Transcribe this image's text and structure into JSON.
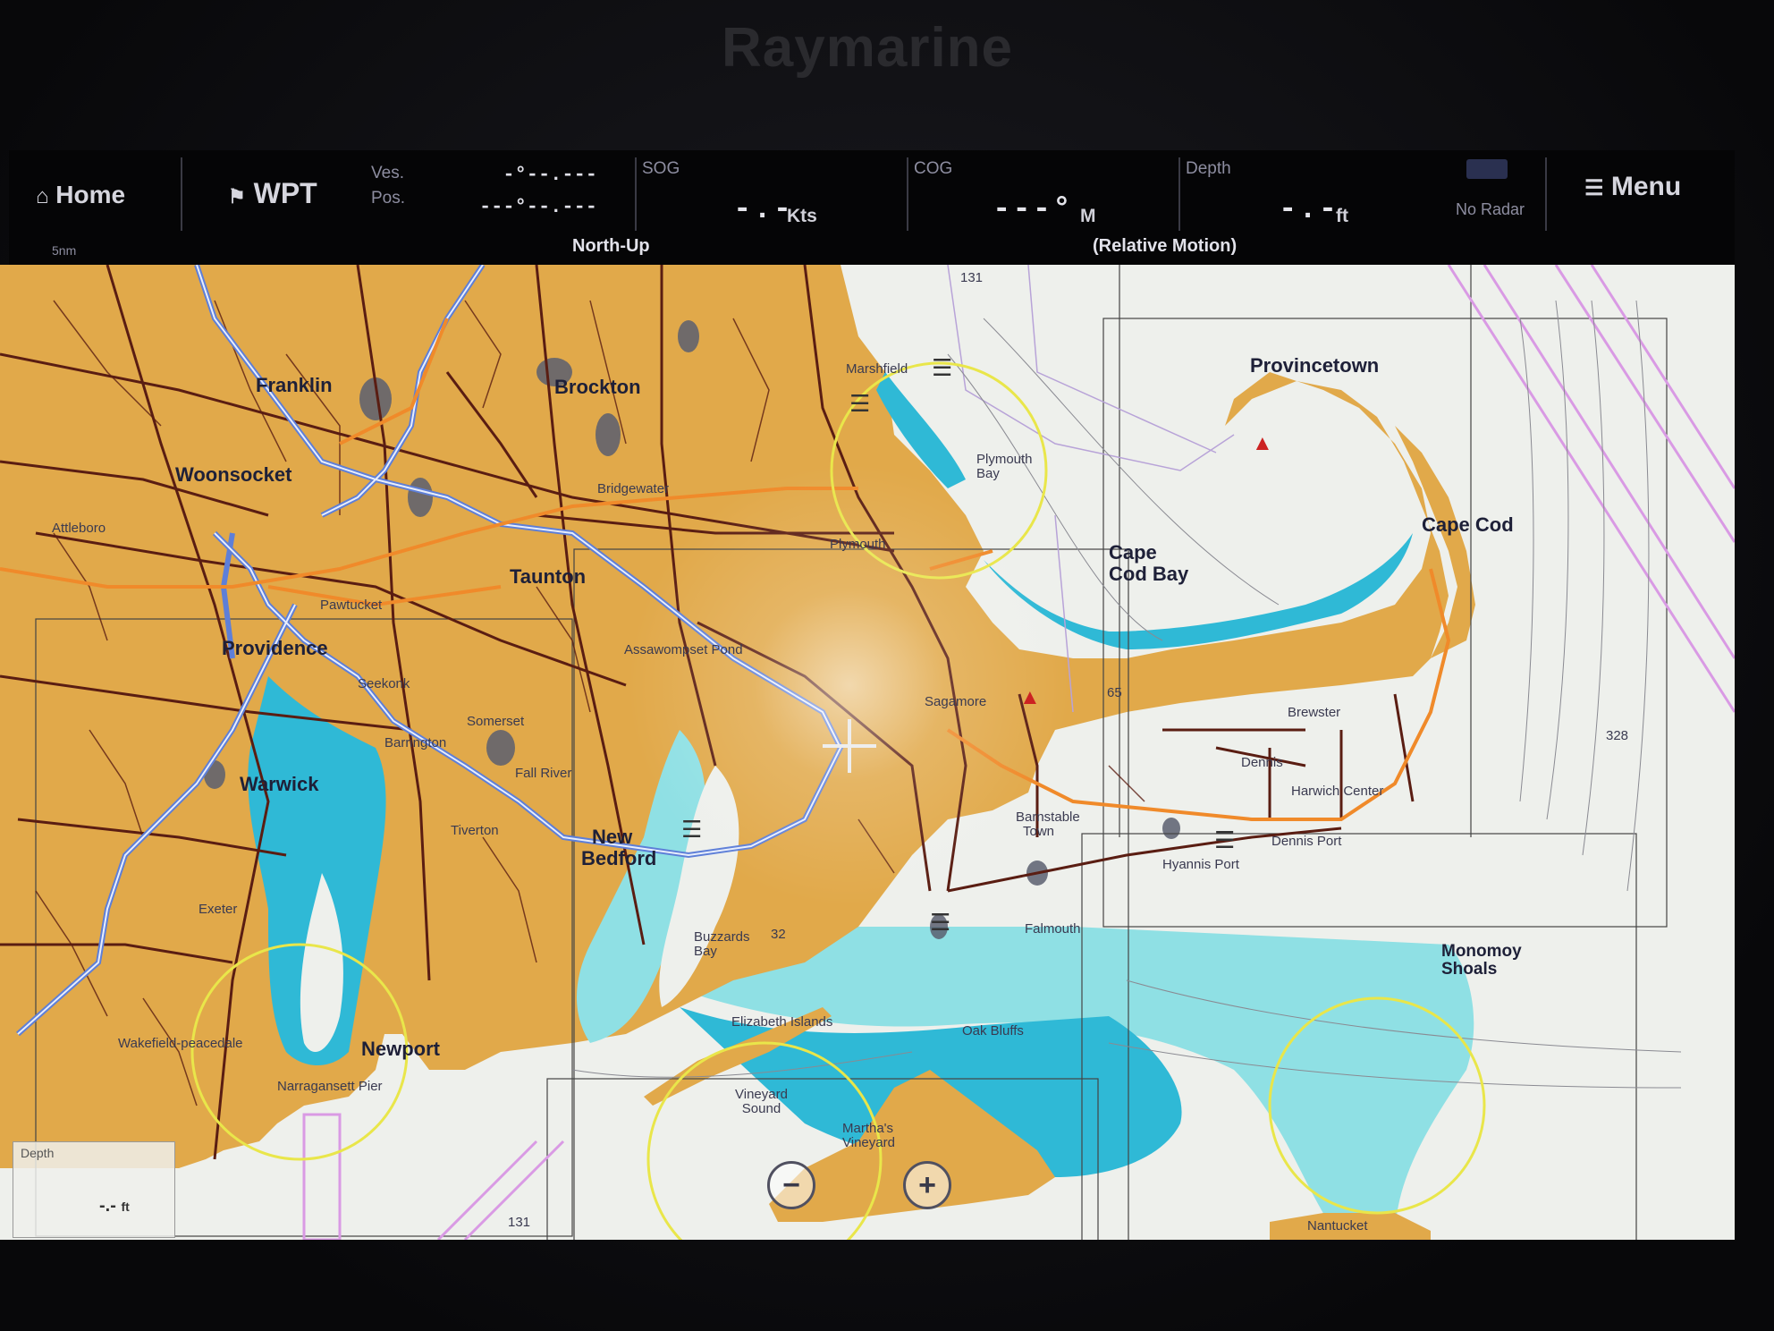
{
  "device": {
    "brand": "Raymarine"
  },
  "databar": {
    "home": "Home",
    "wpt": "WPT",
    "ves_pos_label_1": "Ves.",
    "ves_pos_label_2": "Pos.",
    "ves_pos_line1": "-°--.---",
    "ves_pos_line2": "---°--.---",
    "scale": "5nm",
    "sog_label": "SOG",
    "sog_value": "-.-",
    "sog_unit": "Kts",
    "cog_label": "COG",
    "cog_value": "---°",
    "cog_unit": "M",
    "depth_label": "Depth",
    "depth_value": "-.-",
    "depth_unit": "ft",
    "radar": "No Radar",
    "menu": "Menu",
    "orientation": "North-Up",
    "motion": "(Relative Motion)"
  },
  "map": {
    "places": {
      "provincetown": "Provincetown",
      "cape_cod": "Cape Cod",
      "cape_cod_bay_1": "Cape",
      "cape_cod_bay_2": "Cod Bay",
      "brockton": "Brockton",
      "franklin": "Franklin",
      "woonsocket": "Woonsocket",
      "taunton": "Taunton",
      "providence": "Providence",
      "warwick": "Warwick",
      "new_bedford_1": "New",
      "new_bedford_2": "Bedford",
      "newport": "Newport",
      "monomoy_1": "Monomoy",
      "monomoy_2": "Shoals",
      "marshfield": "Marshfield",
      "plymouth_bay_1": "Plymouth",
      "plymouth_bay_2": "Bay",
      "plymouth": "Plymouth",
      "bridgewater": "Bridgewater",
      "assawompset": "Assawompset Pond",
      "seekonk": "Seekonk",
      "somerset": "Somerset",
      "barrington": "Barrington",
      "fall_river": "Fall River",
      "tiverton": "Tiverton",
      "exeter": "Exeter",
      "sagamore": "Sagamore",
      "brewster": "Brewster",
      "dennis": "Dennis",
      "harwich_center": "Harwich Center",
      "dennis_port": "Dennis Port",
      "hyannis_port": "Hyannis Port",
      "barnstable_1": "Barnstable",
      "barnstable_2": "Town",
      "falmouth": "Falmouth",
      "buzzards_1": "Buzzards",
      "buzzards_2": "Bay",
      "elizabeth_islands": "Elizabeth Islands",
      "oak_bluffs": "Oak Bluffs",
      "vineyard_sound_1": "Vineyard",
      "vineyard_sound_2": "Sound",
      "marthas_1": "Martha's",
      "marthas_2": "Vineyard",
      "narragansett_pier": "Narragansett Pier",
      "wakefield": "Wakefield-peacedale",
      "nantucket": "Nantucket",
      "attleboro": "Attleboro",
      "pawtucket": "Pawtucket"
    },
    "soundings": {
      "s131_top": "131",
      "s65": "65",
      "s328": "328",
      "s32": "32",
      "s131_bottom": "131"
    },
    "depth_box": {
      "label": "Depth",
      "value": "-.-",
      "unit": "ft"
    }
  },
  "colors": {
    "land": "#e1a94a",
    "shallow": "#2fb9d6",
    "shoal": "#8fe0e4",
    "deep": "#eef0ec",
    "road": "#5a1d12",
    "highway": "#5e7fd8",
    "route": "#f08a2a",
    "marker": "#e9e64a",
    "boundary": "#d99ae4"
  },
  "icons": [
    "home-icon",
    "waypoint-icon",
    "menu-icon",
    "cursor-icon",
    "zoom-out-icon",
    "zoom-in-icon",
    "lighthouse-icon"
  ]
}
